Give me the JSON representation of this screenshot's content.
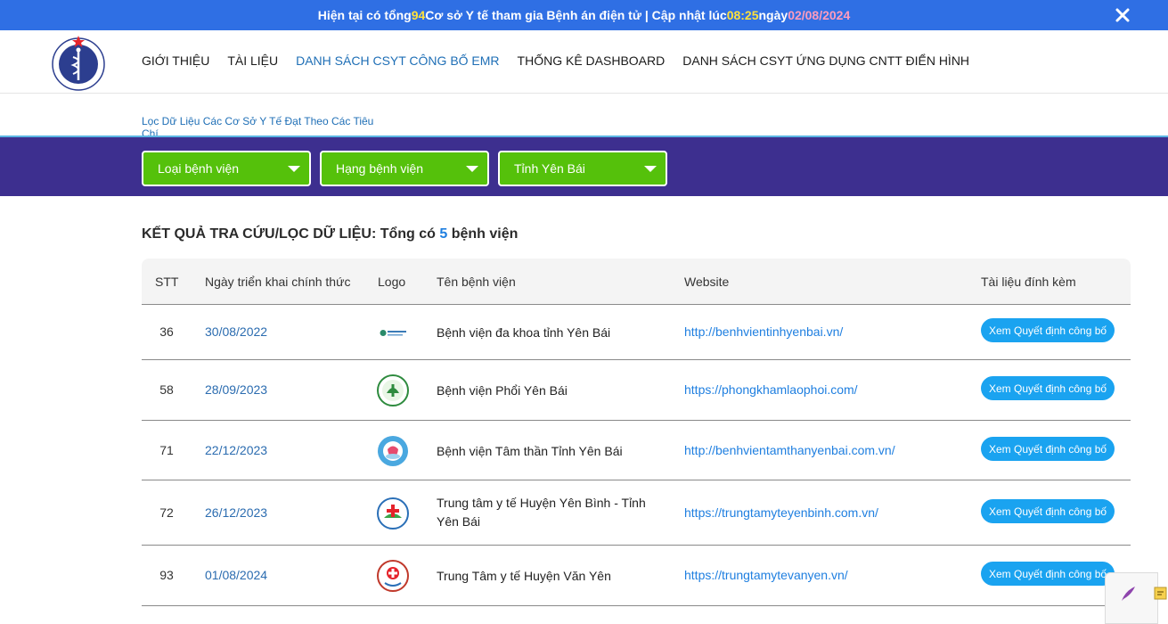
{
  "banner": {
    "prefix": "Hiện tại có tổng ",
    "total": "94",
    "middle": " Cơ sở Y tế tham gia Bệnh án điện tử | Cập nhật lúc ",
    "time": "08:25",
    "date_prefix": " ngày ",
    "date": "02/08/2024"
  },
  "nav": {
    "items": [
      {
        "label": "GIỚI THIỆU"
      },
      {
        "label": "TÀI LIỆU"
      },
      {
        "label": "DANH SÁCH CSYT CÔNG BỐ EMR"
      },
      {
        "label": "THỐNG KÊ DASHBOARD"
      },
      {
        "label": "DANH SÁCH CSYT ỨNG DỤNG CNTT ĐIỂN HÌNH"
      }
    ]
  },
  "logo": {
    "top_text": "BỘ Y TẾ",
    "bottom_text": "MINISTRY OF HEALTH"
  },
  "subtab": "Lọc Dữ Liệu Các Cơ Sở Y Tế Đạt Theo Các Tiêu Chí",
  "filters": [
    {
      "value": "Loại bệnh viện"
    },
    {
      "value": "Hạng bệnh viện"
    },
    {
      "value": "Tỉnh Yên Bái"
    }
  ],
  "result": {
    "prefix": "KẾT QUẢ TRA CỨU/LỌC DỮ LIỆU: Tổng có ",
    "count": "5",
    "suffix": " bệnh viện"
  },
  "table": {
    "headers": {
      "stt": "STT",
      "date": "Ngày triển khai chính thức",
      "logo": "Logo",
      "name": "Tên bệnh viện",
      "website": "Website",
      "attachment": "Tài liệu đính kèm"
    },
    "rows": [
      {
        "stt": "36",
        "date": "30/08/2022",
        "name": "Bệnh viện đa khoa tỉnh Yên Bái",
        "website": "http://benhvientinhyenbai.vn/",
        "button": "Xem Quyết định công bố",
        "logo_icon": "hospital-banner-logo"
      },
      {
        "stt": "58",
        "date": "28/09/2023",
        "name": "Bệnh viện Phổi Yên Bái",
        "website": "https://phongkhamlaophoi.com/",
        "button": "Xem Quyết định công bố",
        "logo_icon": "lung-hospital-logo"
      },
      {
        "stt": "71",
        "date": "22/12/2023",
        "name": "Bệnh viện Tâm thần Tỉnh Yên Bái",
        "website": "http://benhvientamthanyenbai.com.vn/",
        "button": "Xem Quyết định công bố",
        "logo_icon": "mental-hospital-logo"
      },
      {
        "stt": "72",
        "date": "26/12/2023",
        "name": "Trung tâm y tế Huyện Yên Bình - Tỉnh Yên Bái",
        "website": "https://trungtamyteyenbinh.com.vn/",
        "button": "Xem Quyết định công bố",
        "logo_icon": "yen-binh-health-logo"
      },
      {
        "stt": "93",
        "date": "01/08/2024",
        "name": "Trung Tâm y tế Huyện Văn Yên",
        "website": "https://trungtamytevanyen.vn/",
        "button": "Xem Quyết định công bố",
        "logo_icon": "van-yen-health-logo"
      }
    ]
  },
  "colors": {
    "banner": "#2f6fe4",
    "filter_bar": "#3d2f8f",
    "select": "#55c10b",
    "button": "#1aa3f0",
    "link": "#1f7fe0"
  }
}
